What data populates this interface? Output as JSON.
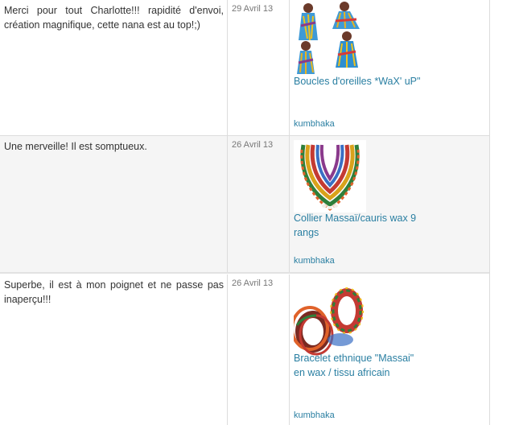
{
  "reviews": [
    {
      "comment": "Merci pour tout Charlotte!!! rapidité d'envoi, création magnifique, cette nana est au top!;)",
      "date": "29 Avril 13",
      "product_title": "Boucles d'oreilles *WaX' uP\"",
      "shop": "kumbhaka",
      "image": "earrings-thumbnail"
    },
    {
      "comment": "Une merveille! Il est somptueux.",
      "date": "26 Avril 13",
      "product_title": "Collier Massaï/cauris wax 9 rangs",
      "shop": "kumbhaka",
      "image": "necklace-thumbnail"
    },
    {
      "comment": "Superbe, il est à mon poignet et ne passe pas inaperçu!!!",
      "date": "26 Avril 13",
      "product_title": "Bracelet ethnique \"Massai\" en wax / tissu africain",
      "shop": "kumbhaka",
      "image": "bracelet-thumbnail"
    }
  ]
}
